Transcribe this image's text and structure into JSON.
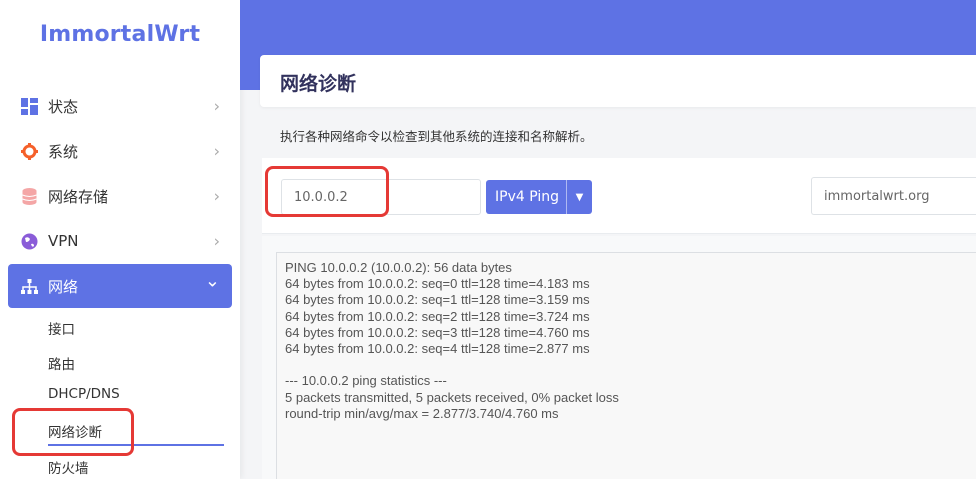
{
  "app": {
    "logo": "ImmortalWrt"
  },
  "sidebar": {
    "items": [
      {
        "label": "状态",
        "icon": "dashboard-icon",
        "chevron": "›"
      },
      {
        "label": "系统",
        "icon": "gear-icon",
        "chevron": "›"
      },
      {
        "label": "网络存储",
        "icon": "database-icon",
        "chevron": "›"
      },
      {
        "label": "VPN",
        "icon": "globe-icon",
        "chevron": "›"
      },
      {
        "label": "网络",
        "icon": "network-icon",
        "chevron": "⌄"
      }
    ],
    "sub_items": [
      "接口",
      "路由",
      "DHCP/DNS",
      "网络诊断",
      "防火墙"
    ],
    "active_sub": "网络诊断"
  },
  "page": {
    "title": "网络诊断",
    "description": "执行各种网络命令以检查到其他系统的连接和名称解析。"
  },
  "tools": {
    "ping_host": "10.0.0.2",
    "ping_button": "IPv4 Ping",
    "caret": "▼",
    "lookup_host": "immortalwrt.org"
  },
  "output": {
    "text": "PING 10.0.0.2 (10.0.0.2): 56 data bytes\n64 bytes from 10.0.0.2: seq=0 ttl=128 time=4.183 ms\n64 bytes from 10.0.0.2: seq=1 ttl=128 time=3.159 ms\n64 bytes from 10.0.0.2: seq=2 ttl=128 time=3.724 ms\n64 bytes from 10.0.0.2: seq=3 ttl=128 time=4.760 ms\n64 bytes from 10.0.0.2: seq=4 ttl=128 time=2.877 ms\n\n--- 10.0.0.2 ping statistics ---\n5 packets transmitted, 5 packets received, 0% packet loss\nround-trip min/avg/max = 2.877/3.740/4.760 ms"
  },
  "colors": {
    "accent": "#5e72e4",
    "highlight": "#e53935",
    "gear": "#f5602a",
    "database": "#f4a6a6",
    "globe": "#8a5cd8"
  }
}
